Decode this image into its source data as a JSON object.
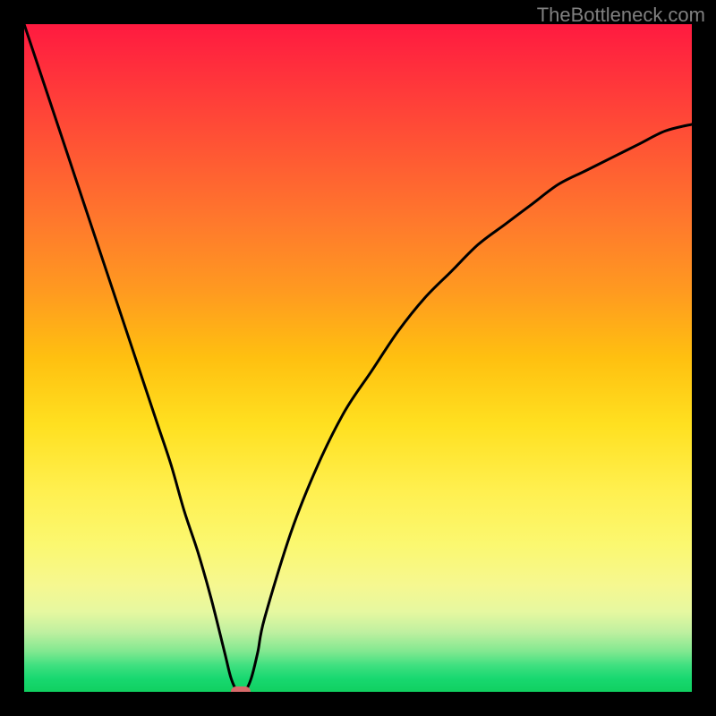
{
  "watermark": "TheBottleneck.com",
  "colors": {
    "frame": "#000000",
    "curve": "#000000",
    "marker": "#d86a6a",
    "watermark_text": "#808080"
  },
  "chart_data": {
    "type": "line",
    "title": "",
    "xlabel": "",
    "ylabel": "",
    "xlim": [
      0,
      100
    ],
    "ylim": [
      0,
      100
    ],
    "x": [
      0,
      2,
      4,
      6,
      8,
      10,
      12,
      14,
      16,
      18,
      20,
      22,
      24,
      26,
      28,
      30,
      31,
      32,
      33,
      34,
      35,
      36,
      40,
      44,
      48,
      52,
      56,
      60,
      64,
      68,
      72,
      76,
      80,
      84,
      88,
      92,
      96,
      100
    ],
    "y": [
      100,
      94,
      88,
      82,
      76,
      70,
      64,
      58,
      52,
      46,
      40,
      34,
      27,
      21,
      14,
      6,
      2,
      0,
      0,
      2,
      6,
      11,
      24,
      34,
      42,
      48,
      54,
      59,
      63,
      67,
      70,
      73,
      76,
      78,
      80,
      82,
      84,
      85
    ],
    "marker": {
      "x": 32.5,
      "y": 0
    },
    "grid": false,
    "legend": false
  }
}
